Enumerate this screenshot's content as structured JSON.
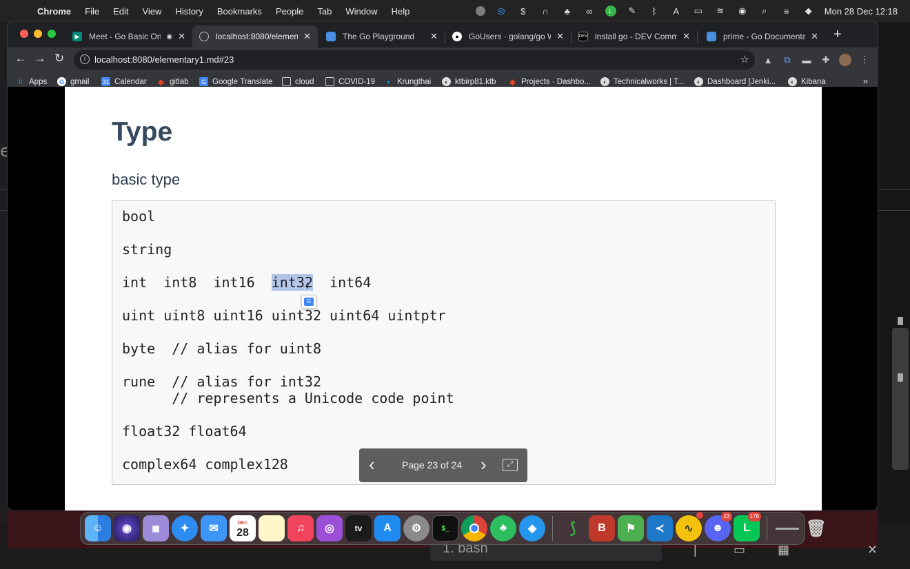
{
  "menubar": {
    "app": "Chrome",
    "items": [
      "File",
      "Edit",
      "View",
      "History",
      "Bookmarks",
      "People",
      "Tab",
      "Window",
      "Help"
    ],
    "datetime": "Mon 28 Dec  12:18"
  },
  "tabs": [
    {
      "title": "Meet - Go Basic Onlin",
      "active": false,
      "favicon": "meet-icon"
    },
    {
      "title": "localhost:8080/elementar",
      "active": true,
      "favicon": "globe-icon"
    },
    {
      "title": "The Go Playground",
      "active": false,
      "favicon": "doc-icon"
    },
    {
      "title": "GoUsers · golang/go Wiki",
      "active": false,
      "favicon": "github-icon"
    },
    {
      "title": "install go - DEV Communi",
      "active": false,
      "favicon": "dev-icon"
    },
    {
      "title": "prime - Go Documentatio",
      "active": false,
      "favicon": "doc-icon"
    }
  ],
  "toolbar": {
    "url": "localhost:8080/elementary1.md#23"
  },
  "bookmarks": [
    {
      "label": "Apps"
    },
    {
      "label": "gmail"
    },
    {
      "label": "Calendar"
    },
    {
      "label": "gitlab"
    },
    {
      "label": "Google Translate"
    },
    {
      "label": "cloud"
    },
    {
      "label": "COVID-19"
    },
    {
      "label": "Krungthai"
    },
    {
      "label": "ktbirp81.ktb"
    },
    {
      "label": "Projects · Dashbo..."
    },
    {
      "label": "Technicalworks | T..."
    },
    {
      "label": "Dashboard [Jenki..."
    },
    {
      "label": "Kibana"
    }
  ],
  "slide": {
    "title": "Type",
    "subtitle": "basic type",
    "code": {
      "line1": "bool",
      "line2": "string",
      "line3_a": "int  int8  int16  ",
      "line3_sel": "int32",
      "line3_b": "  int64",
      "line4": "uint uint8 uint16 uint32 uint64 uintptr",
      "line5": "byte  // alias for uint8",
      "line6": "rune  // alias for int32",
      "line7": "      // represents a Unicode code point",
      "line8": "float32 float64",
      "line9": "complex64 complex128"
    }
  },
  "pager": {
    "label": "Page 23 of 24"
  },
  "dock": {
    "calendar_month": "DEC",
    "calendar_day": "28",
    "discord_badge": "23",
    "line_badge": "176",
    "tv_label": "tv"
  },
  "background": {
    "terminal_tab": "1. bash"
  }
}
